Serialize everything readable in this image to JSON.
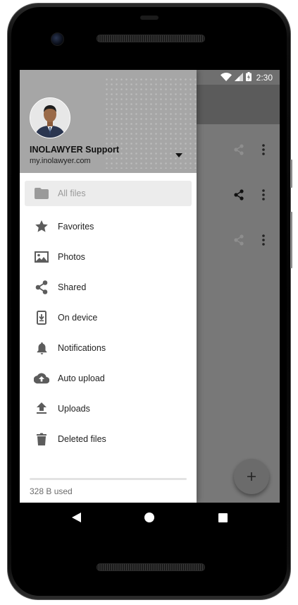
{
  "statusbar": {
    "time": "2:30"
  },
  "account": {
    "name": "INOLAWYER Support",
    "server": "my.inolawyer.com"
  },
  "menu": [
    {
      "label": "All files",
      "icon": "folder-icon",
      "active": true
    },
    {
      "label": "Favorites",
      "icon": "star-icon"
    },
    {
      "label": "Photos",
      "icon": "image-icon"
    },
    {
      "label": "Shared",
      "icon": "share-icon"
    },
    {
      "label": "On device",
      "icon": "device-download-icon"
    },
    {
      "label": "Notifications",
      "icon": "bell-icon"
    },
    {
      "label": "Auto upload",
      "icon": "cloud-upload-icon"
    },
    {
      "label": "Uploads",
      "icon": "upload-icon"
    },
    {
      "label": "Deleted files",
      "icon": "trash-icon"
    }
  ],
  "quota": {
    "text": "328 B used"
  },
  "fab": {
    "symbol": "+"
  },
  "colors": {
    "drawer_header": "#a6a6a6",
    "scrim_background": "#787878",
    "active_item_bg": "#ececec"
  }
}
